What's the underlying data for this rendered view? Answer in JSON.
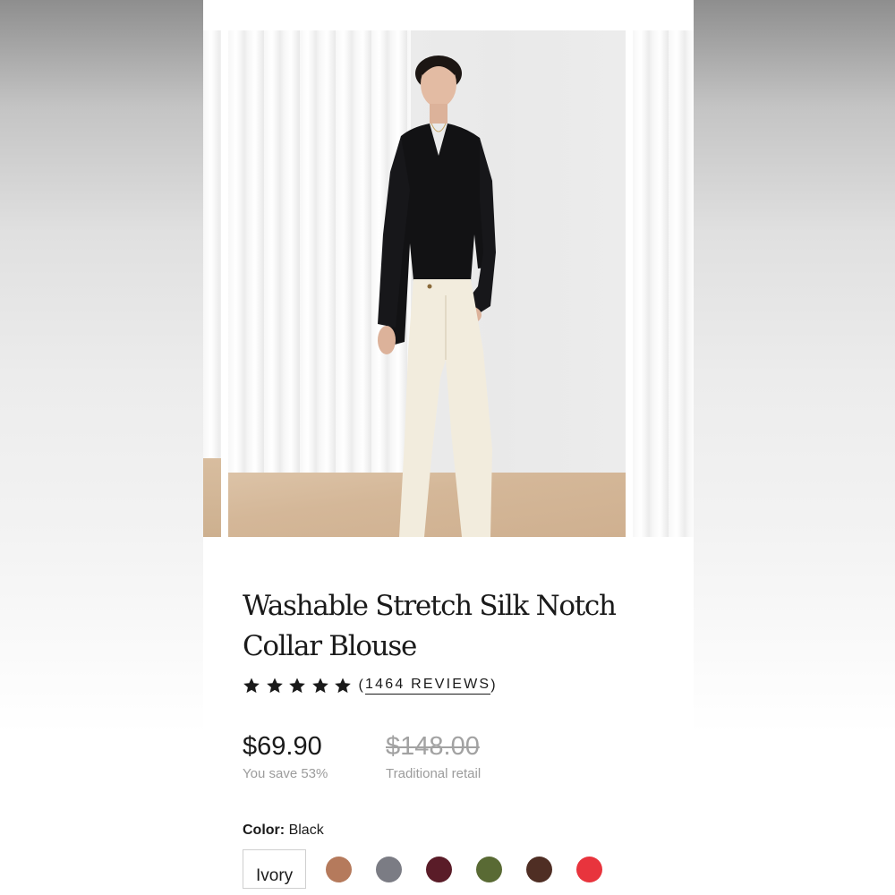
{
  "product": {
    "title_line1": "Washable Stretch Silk Notch",
    "title_line2": "Collar Blouse",
    "rating_stars": 5,
    "reviews_open": "(",
    "reviews_label": "1464 REVIEWS",
    "reviews_close": ")",
    "price": "$69.90",
    "savings": "You save 53%",
    "retail_price": "$148.00",
    "retail_label": "Traditional retail"
  },
  "color": {
    "label_key": "Color:",
    "selected": "Black",
    "swatches": [
      {
        "label": "Ivory",
        "color": "#ffffff"
      },
      {
        "label": "",
        "color": "#b57a5c"
      },
      {
        "label": "",
        "color": "#7b7c84"
      },
      {
        "label": "",
        "color": "#5a1c28"
      },
      {
        "label": "",
        "color": "#596a34"
      },
      {
        "label": "",
        "color": "#4f2e24"
      },
      {
        "label": "",
        "color": "#e8343d"
      }
    ]
  },
  "colors": {
    "text": "#1a1a1a",
    "muted": "#9c9c9c",
    "star": "#1a1a1a"
  }
}
